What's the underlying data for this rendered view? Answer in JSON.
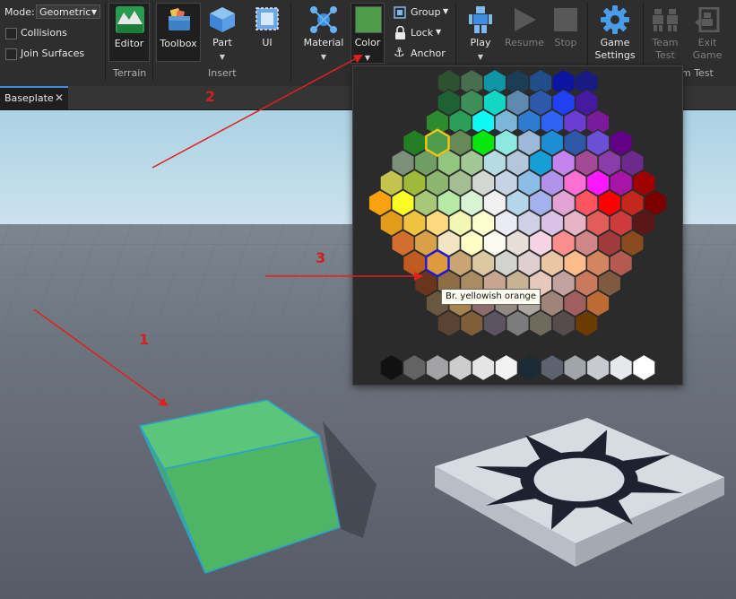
{
  "toolbar": {
    "mode_label": "Mode:",
    "mode_value": "Geometric",
    "collisions_label": "Collisions",
    "join_surfaces_label": "Join Surfaces",
    "editor_label": "Editor",
    "terrain_group": "Terrain",
    "toolbox_label": "Toolbox",
    "part_label": "Part",
    "ui_label": "UI",
    "insert_group": "Insert",
    "material_label": "Material",
    "color_label": "Color",
    "group_label": "Group",
    "lock_label": "Lock",
    "anchor_label": "Anchor",
    "play_label": "Play",
    "resume_label": "Resume",
    "stop_label": "Stop",
    "game_settings_label": "Game Settings",
    "team_test_label": "Team Test",
    "exit_game_label": "Exit Game",
    "team_test_group": "m Test",
    "color_swatch": "#4c9c4c"
  },
  "tabs": {
    "active_label": "Baseplate"
  },
  "palette": {
    "selected_color": "#4c9c4c",
    "hover_color": "#e09a3e",
    "hover_name": "Br. yellowish orange",
    "rows": [
      [
        "#2f5132",
        "#486d4f",
        "#0e96a7",
        "#1d3c55",
        "#1f4e8a",
        "#0a15a2",
        "#1a1a83"
      ],
      [
        "#1e6234",
        "#3d8e59",
        "#13d6c4",
        "#5e8ab0",
        "#2d58ab",
        "#1f40f5",
        "#451aa1"
      ],
      [
        "#2c8a2f",
        "#2b9e59",
        "#0ff8f4",
        "#7bb6d9",
        "#2e7cd0",
        "#3063f3",
        "#6b3cd6",
        "#7b1b9c"
      ],
      [
        "#247e24",
        "#4c9c4c",
        "#678a56",
        "#07e70d",
        "#8ee8e2",
        "#9db8d8",
        "#1f8dd2",
        "#2e57a8",
        "#6c4fd6",
        "#620087"
      ],
      [
        "#7b8f79",
        "#6f9d63",
        "#92c57d",
        "#a2c795",
        "#b6dce3",
        "#b2c8da",
        "#169fd6",
        "#c284ec",
        "#a44a95",
        "#8a3cab",
        "#6d2a8c"
      ],
      [
        "#c4c34d",
        "#9fb93a",
        "#8cb56f",
        "#a4bd93",
        "#d3d7d4",
        "#c6d3e7",
        "#8bbde7",
        "#b192ea",
        "#ff6ed3",
        "#ff18ff",
        "#a815a6",
        "#9f0000"
      ],
      [
        "#f8a20f",
        "#fbfb2a",
        "#a6c878",
        "#b6e8a6",
        "#d7f3d4",
        "#f1f1f1",
        "#b5d5eb",
        "#a5b1ed",
        "#e3a4d5",
        "#ff5563",
        "#ff0000",
        "#c4281c",
        "#7a0000"
      ],
      [
        "#e29c1a",
        "#efc23f",
        "#ffd97f",
        "#f4f6b4",
        "#fdfdd0",
        "#ebebf5",
        "#cfd0e6",
        "#d9c2e5",
        "#e9b3c6",
        "#e25c5c",
        "#cd3b3b",
        "#5a1717"
      ],
      [
        "#d36e31",
        "#d7a049",
        "#f2e6c2",
        "#fefdc7",
        "#fafaf0",
        "#e7ded8",
        "#f6d2e7",
        "#fc8e8e",
        "#d08586",
        "#a13b3b",
        "#8a4c1f"
      ],
      [
        "#c15a1f",
        "#e09a3e",
        "#c8a572",
        "#dbc7a1",
        "#d2d2cf",
        "#e0cfd0",
        "#eac6a4",
        "#ffbb8c",
        "#d3855e",
        "#b45a4f"
      ],
      [
        "#69361d",
        "#8e6d44",
        "#aa8c63",
        "#c7a591",
        "#c7b394",
        "#e8c7bd",
        "#c1a29e",
        "#c8795e",
        "#7f5a41"
      ],
      [
        "#6a5740",
        "#a68452",
        "#8c6c6c",
        "#928981",
        "#aba6a0",
        "#a08379",
        "#a0605f",
        "#bd6b34"
      ],
      [
        "#5b4334",
        "#7e5d38",
        "#5b5460",
        "#7c7c7c",
        "#6e6b5d",
        "#574c4c",
        "#6d3a00"
      ],
      [
        "#111111",
        "#636363",
        "#a3a2a5",
        "#cdcdcd",
        "#e5e5e5",
        "#f2f2f2",
        "#1b2a35",
        "#5c6270",
        "#a0a4ab",
        "#c7cbd1",
        "#e6e8ec",
        "#ffffff"
      ]
    ]
  },
  "annotations": [
    "1",
    "2",
    "3"
  ]
}
